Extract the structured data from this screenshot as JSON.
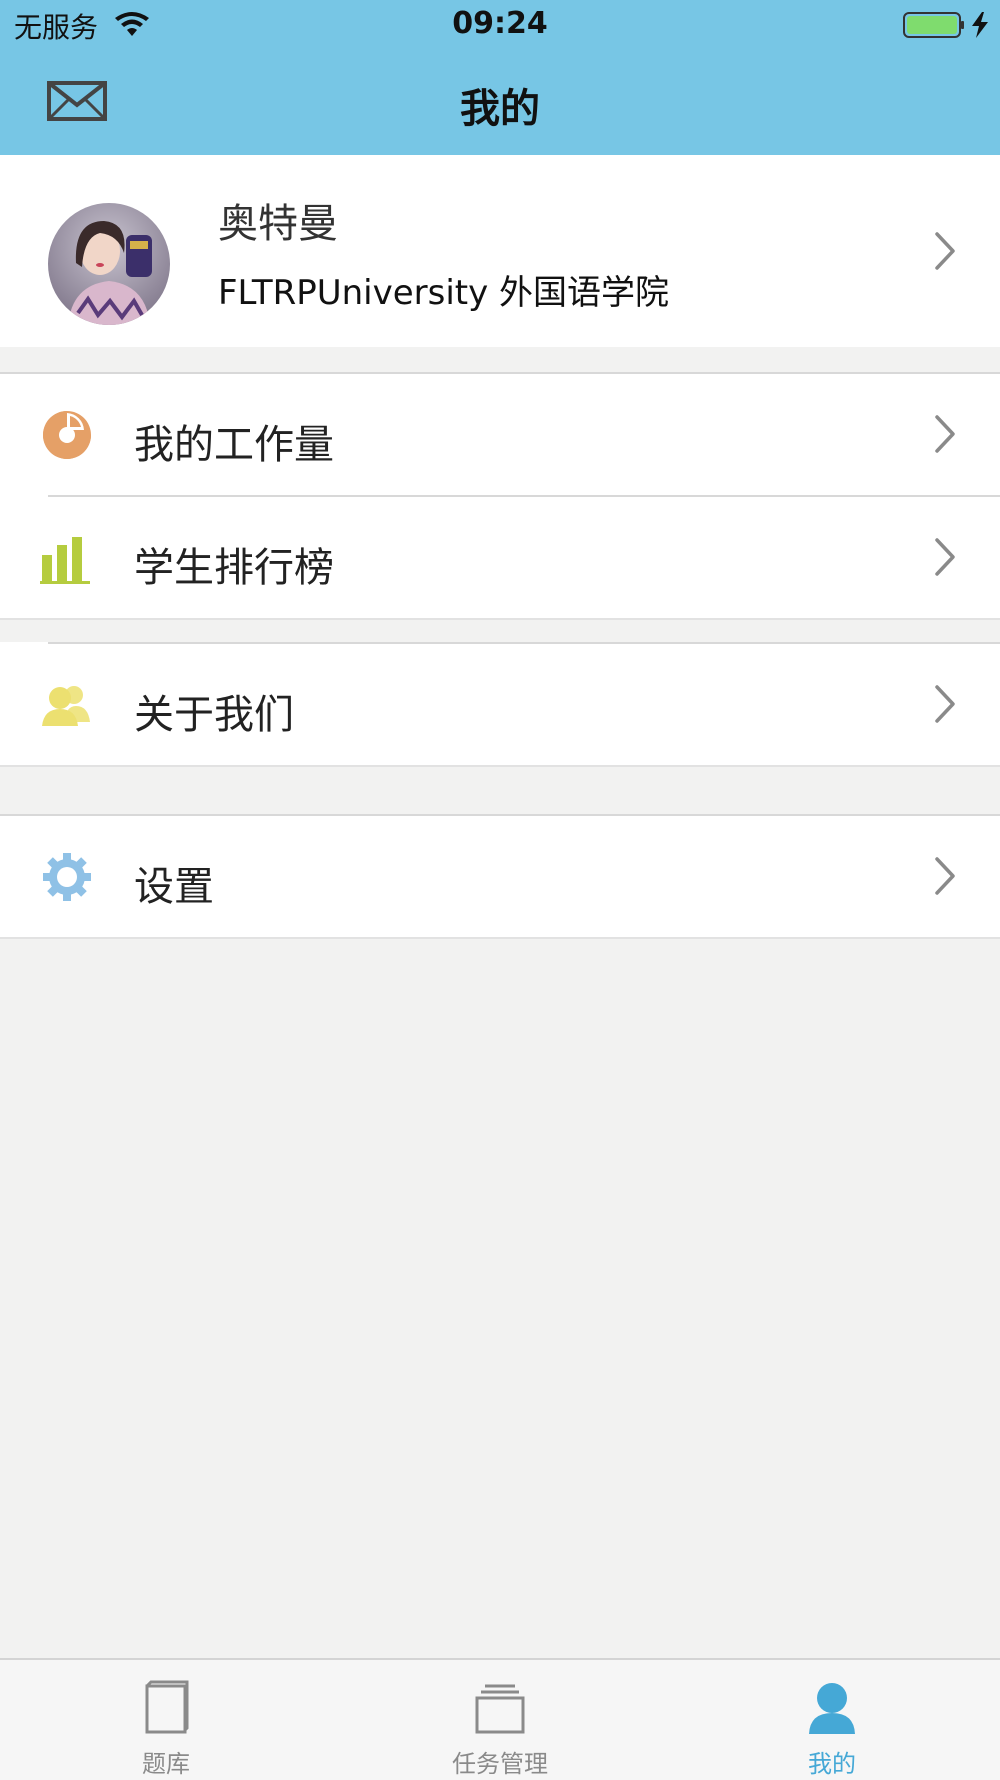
{
  "status_bar": {
    "carrier": "无服务",
    "time": "09:24"
  },
  "nav": {
    "title": "我的",
    "left_icon": "mail-icon"
  },
  "profile": {
    "name": "奥特曼",
    "organization": "FLTRPUniversity 外国语学院"
  },
  "menu": {
    "workload": "我的工作量",
    "ranking": "学生排行榜",
    "about": "关于我们",
    "settings": "设置"
  },
  "icons": {
    "workload": "pie-chart-icon",
    "ranking": "bar-chart-icon",
    "about": "people-icon",
    "settings": "gear-icon"
  },
  "tabs": [
    {
      "label": "题库",
      "icon": "book-icon",
      "active": false
    },
    {
      "label": "任务管理",
      "icon": "stack-icon",
      "active": false
    },
    {
      "label": "我的",
      "icon": "person-icon",
      "active": true
    }
  ],
  "colors": {
    "header": "#77c6e5",
    "workload_icon": "#e5a067",
    "ranking_icon": "#b5cc3f",
    "about_icon": "#ece070",
    "settings_icon": "#8fc1e6",
    "tab_active": "#45a8d6",
    "tab_inactive": "#8a8a8a"
  }
}
